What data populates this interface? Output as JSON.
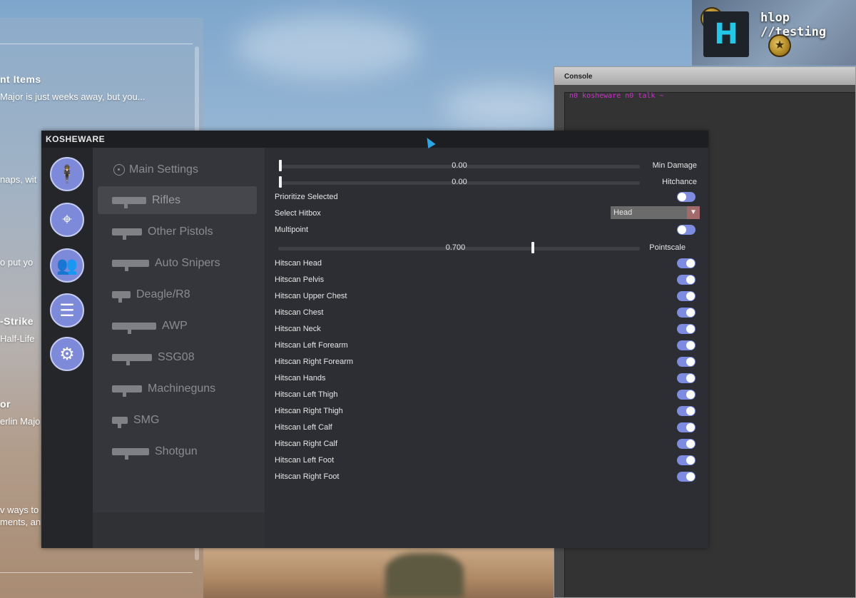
{
  "news": [
    {
      "title": "nt Items",
      "body": "Major is just weeks away, but you..."
    },
    {
      "title": "",
      "body": "naps, wit"
    },
    {
      "title": "",
      "body": "o put yo"
    },
    {
      "title": "-Strike",
      "body": "Half-Life"
    },
    {
      "title": "or",
      "body": "erlin Majo"
    },
    {
      "title": "",
      "body": "v ways to"
    },
    {
      "title": "",
      "body": "ments, an"
    }
  ],
  "profile": {
    "avatar_letter": "H",
    "username": "hlop //testing"
  },
  "console": {
    "title": "Console",
    "output_line": "n0 kosheware n0 talk ~"
  },
  "menu": {
    "brand": "KOSHEWARE",
    "tabs": [
      {
        "name": "legit-tab",
        "icon": "soldier-icon",
        "glyph": "🕴"
      },
      {
        "name": "rage-tab",
        "icon": "crosshair-icon",
        "glyph": "⌖"
      },
      {
        "name": "visuals-tab",
        "icon": "players-icon",
        "glyph": "👥"
      },
      {
        "name": "misc-tab",
        "icon": "checklist-icon",
        "glyph": "☰"
      },
      {
        "name": "settings-tab",
        "icon": "gears-icon",
        "glyph": "⚙"
      }
    ],
    "weapons": [
      {
        "label": "Main Settings",
        "icon": "crosshair-icon",
        "active": false
      },
      {
        "label": "Rifles",
        "icon": "rifle-icon",
        "active": true
      },
      {
        "label": "Other Pistols",
        "icon": "pistol-icon",
        "active": false
      },
      {
        "label": "Auto Snipers",
        "icon": "auto-sniper-icon",
        "active": false
      },
      {
        "label": "Deagle/R8",
        "icon": "deagle-icon",
        "active": false
      },
      {
        "label": "AWP",
        "icon": "awp-icon",
        "active": false
      },
      {
        "label": "SSG08",
        "icon": "ssg08-icon",
        "active": false
      },
      {
        "label": "Machineguns",
        "icon": "machinegun-icon",
        "active": false
      },
      {
        "label": "SMG",
        "icon": "smg-icon",
        "active": false
      },
      {
        "label": "Shotgun",
        "icon": "shotgun-icon",
        "active": false
      }
    ],
    "settings": {
      "min_damage": {
        "label": "Min Damage",
        "value": "0.00"
      },
      "hitchance": {
        "label": "Hitchance",
        "value": "0.00"
      },
      "prioritize_selected": {
        "label": "Prioritize Selected",
        "on": false
      },
      "select_hitbox": {
        "label": "Select Hitbox",
        "value": "Head"
      },
      "multipoint": {
        "label": "Multipoint",
        "on": false
      },
      "pointscale": {
        "label": "Pointscale",
        "value": "0.700",
        "fraction": 0.7
      },
      "hitscan": [
        "Hitscan Head",
        "Hitscan Pelvis",
        "Hitscan Upper Chest",
        "Hitscan Chest",
        "Hitscan Neck",
        "Hitscan Left Forearm",
        "Hitscan Right Forearm",
        "Hitscan Hands",
        "Hitscan Left Thigh",
        "Hitscan Right Thigh",
        "Hitscan Left Calf",
        "Hitscan Right Calf",
        "Hitscan Left Foot",
        "Hitscan Right Foot"
      ]
    }
  }
}
